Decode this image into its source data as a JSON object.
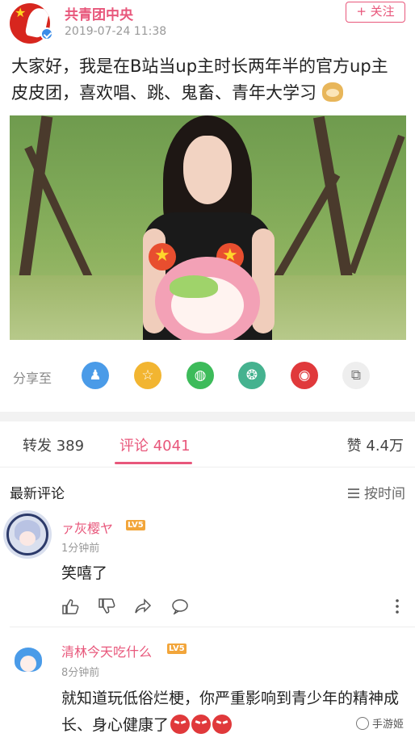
{
  "post": {
    "author": "共青团中央",
    "time": "2019-07-24 11:38",
    "follow_label": "+ 关注",
    "text": "大家好，我是在B站当up主时长两年半的官方up主皮皮团，喜欢唱、跳、鬼畜、青年大学习"
  },
  "share": {
    "label": "分享至",
    "targets": [
      {
        "name": "qq",
        "icon": "qq-icon",
        "color": "#4a9be8"
      },
      {
        "name": "qzone",
        "icon": "qzone-star-icon",
        "color": "#f2b531"
      },
      {
        "name": "wechat",
        "icon": "wechat-icon",
        "color": "#3dbb5a"
      },
      {
        "name": "moments",
        "icon": "moments-icon",
        "color": "#45b28f"
      },
      {
        "name": "weibo",
        "icon": "weibo-icon",
        "color": "#e0393b"
      },
      {
        "name": "copy",
        "icon": "copy-link-icon",
        "color": "#eeeeee"
      }
    ]
  },
  "tabs": {
    "repost": "转发 389",
    "comments": "评论 4041",
    "likes": "赞 4.4万"
  },
  "comments_header": {
    "title": "最新评论",
    "sort": "按时间"
  },
  "comments": [
    {
      "user": "ァ灰樱ヤ",
      "level": "LV5",
      "time": "1分钟前",
      "text": "笑嘻了"
    },
    {
      "user": "清林今天吃什么",
      "level": "LV5",
      "time": "8分钟前",
      "text": "就知道玩低俗烂梗，你严重影响到青少年的精神成长、身心健康了"
    }
  ],
  "watermark": "手游姬",
  "colors": {
    "accent": "#e8577b",
    "level_badge": "#f2a53a"
  }
}
